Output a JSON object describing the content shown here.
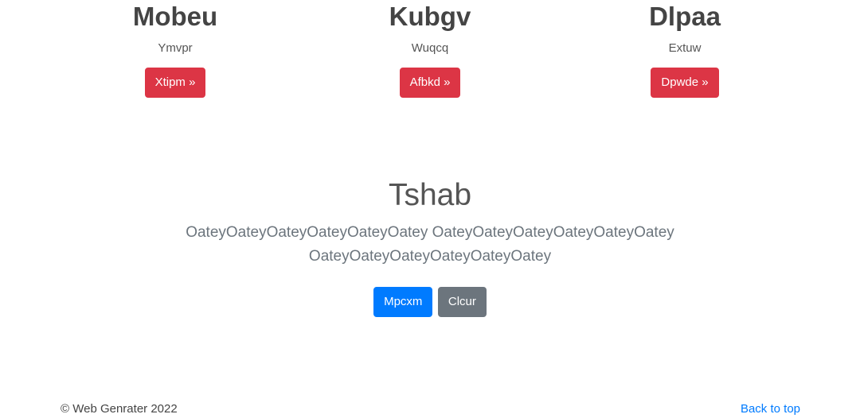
{
  "features": [
    {
      "title": "Mobeu",
      "text": "Ymvpr",
      "button_label": "Xtipm »"
    },
    {
      "title": "Kubgv",
      "text": "Wuqcq",
      "button_label": "Afbkd »"
    },
    {
      "title": "Dlpaa",
      "text": "Extuw",
      "button_label": "Dpwde »"
    }
  ],
  "hero": {
    "title": "Tshab",
    "lead": "OateyOateyOateyOateyOateyOatey OateyOateyOateyOateyOateyOatey OateyOateyOateyOateyOateyOatey",
    "primary_button": "Mpcxm",
    "secondary_button": "Clcur"
  },
  "footer": {
    "copyright": "© Web Genrater 2022",
    "back_to_top": "Back to top"
  },
  "colors": {
    "danger": "#dc3545",
    "primary": "#007bff",
    "secondary": "#6c757d",
    "link": "#007bff"
  }
}
